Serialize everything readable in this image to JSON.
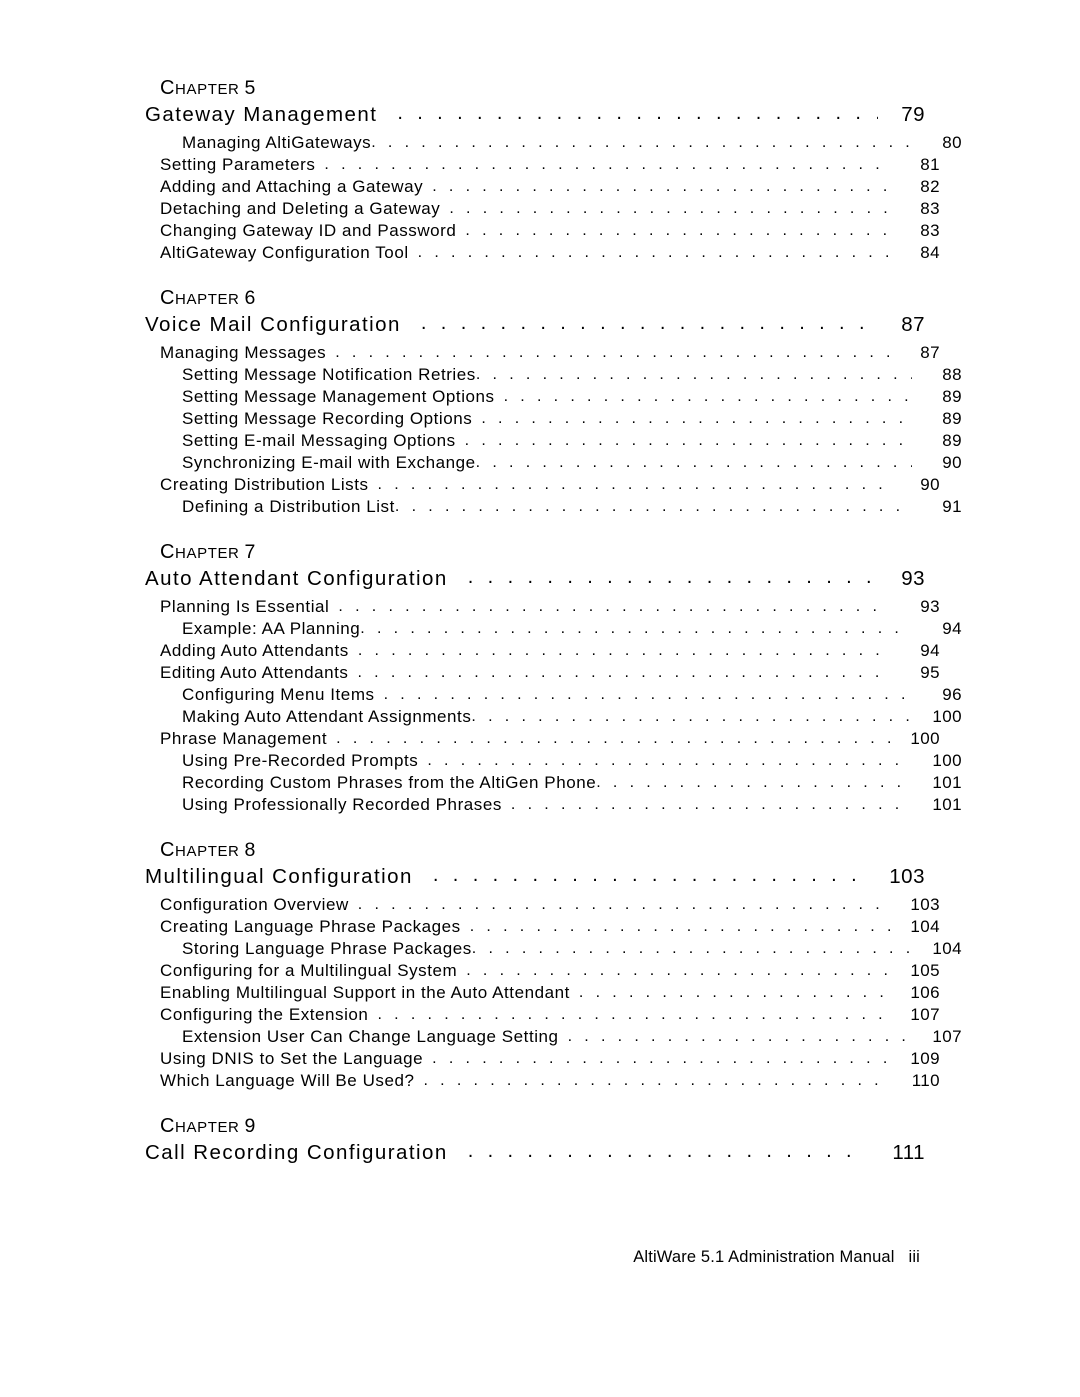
{
  "document": {
    "footer_text": "AltiWare 5.1 Administration Manual",
    "folio": "iii",
    "chapter_word": "Chapter"
  },
  "chapters": [
    {
      "label_cap": "C",
      "label_rest": "HAPTER",
      "number": "5",
      "title": "Gateway Management",
      "page": "79",
      "entries": [
        {
          "level": 2,
          "title": "Managing AltiGateways",
          "page": "80",
          "tight": true
        },
        {
          "level": 1,
          "title": "Setting Parameters",
          "page": "81",
          "tight": false
        },
        {
          "level": 1,
          "title": "Adding and Attaching a Gateway",
          "page": "82",
          "tight": false
        },
        {
          "level": 1,
          "title": "Detaching and Deleting a Gateway",
          "page": "83",
          "tight": false
        },
        {
          "level": 1,
          "title": "Changing Gateway ID and Password",
          "page": "83",
          "tight": false
        },
        {
          "level": 1,
          "title": "AltiGateway Configuration Tool",
          "page": "84",
          "tight": false
        }
      ]
    },
    {
      "label_cap": "C",
      "label_rest": "HAPTER",
      "number": "6",
      "title": "Voice Mail Configuration",
      "page": "87",
      "entries": [
        {
          "level": 1,
          "title": "Managing Messages",
          "page": "87",
          "tight": false
        },
        {
          "level": 2,
          "title": "Setting Message Notification Retries",
          "page": "88",
          "tight": true
        },
        {
          "level": 2,
          "title": "Setting Message Management Options",
          "page": "89",
          "tight": false
        },
        {
          "level": 2,
          "title": "Setting Message Recording Options",
          "page": "89",
          "tight": false
        },
        {
          "level": 2,
          "title": "Setting E-mail Messaging Options",
          "page": "89",
          "tight": false
        },
        {
          "level": 2,
          "title": "Synchronizing E-mail with Exchange",
          "page": "90",
          "tight": true
        },
        {
          "level": 1,
          "title": "Creating Distribution Lists",
          "page": "90",
          "tight": false
        },
        {
          "level": 2,
          "title": "Defining a Distribution List",
          "page": "91",
          "tight": true
        }
      ]
    },
    {
      "label_cap": "C",
      "label_rest": "HAPTER",
      "number": "7",
      "title": "Auto Attendant Configuration",
      "page": "93",
      "entries": [
        {
          "level": 1,
          "title": "Planning Is Essential",
          "page": "93",
          "tight": false
        },
        {
          "level": 2,
          "title": "Example: AA Planning",
          "page": "94",
          "tight": true
        },
        {
          "level": 1,
          "title": "Adding Auto Attendants",
          "page": "94",
          "tight": false
        },
        {
          "level": 1,
          "title": "Editing Auto Attendants",
          "page": "95",
          "tight": false
        },
        {
          "level": 2,
          "title": "Configuring Menu Items",
          "page": "96",
          "tight": false
        },
        {
          "level": 2,
          "title": "Making Auto Attendant Assignments",
          "page": "100",
          "tight": true
        },
        {
          "level": 1,
          "title": "Phrase Management",
          "page": "100",
          "tight": false
        },
        {
          "level": 2,
          "title": "Using Pre-Recorded Prompts",
          "page": "100",
          "tight": false
        },
        {
          "level": 2,
          "title": "Recording Custom Phrases from the AltiGen Phone",
          "page": "101",
          "tight": true
        },
        {
          "level": 2,
          "title": "Using Professionally Recorded Phrases",
          "page": "101",
          "tight": false
        }
      ]
    },
    {
      "label_cap": "C",
      "label_rest": "HAPTER",
      "number": "8",
      "title": "Multilingual Configuration",
      "page": "103",
      "entries": [
        {
          "level": 1,
          "title": "Configuration Overview",
          "page": "103",
          "tight": false
        },
        {
          "level": 1,
          "title": "Creating Language Phrase Packages",
          "page": "104",
          "tight": false
        },
        {
          "level": 2,
          "title": "Storing Language Phrase Packages",
          "page": "104",
          "tight": true
        },
        {
          "level": 1,
          "title": "Configuring for a Multilingual System",
          "page": "105",
          "tight": false
        },
        {
          "level": 1,
          "title": "Enabling Multilingual Support in the Auto Attendant",
          "page": "106",
          "tight": false
        },
        {
          "level": 1,
          "title": "Configuring the Extension",
          "page": "107",
          "tight": false
        },
        {
          "level": 2,
          "title": "Extension User Can Change Language Setting",
          "page": "107",
          "tight": false
        },
        {
          "level": 1,
          "title": "Using DNIS to Set the Language",
          "page": "109",
          "tight": false
        },
        {
          "level": 1,
          "title": "Which Language Will Be Used?",
          "page": "110",
          "tight": false
        }
      ]
    },
    {
      "label_cap": "C",
      "label_rest": "HAPTER",
      "number": "9",
      "title": "Call Recording Configuration",
      "page": "111",
      "entries": []
    }
  ]
}
